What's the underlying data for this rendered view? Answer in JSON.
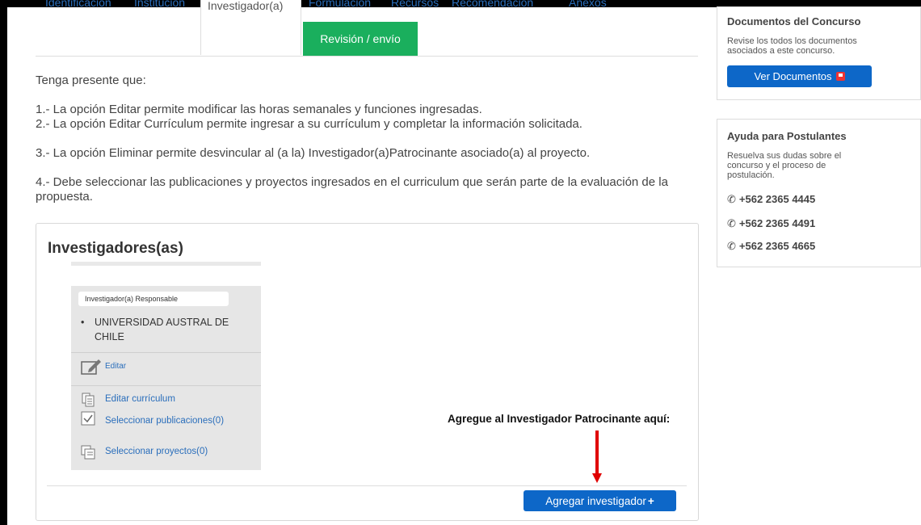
{
  "tabs": {
    "items": [
      "Identificación",
      "Institución",
      "Investigador(a)",
      "Formulación",
      "Recursos",
      "Recomendación",
      "Anexos"
    ],
    "active": "Investigador(a)",
    "review_tab": "Revisión / envío"
  },
  "notes": {
    "intro": "Tenga presente que:",
    "lines": [
      "1.- La opción Editar permite modificar las horas semanales y funciones ingresadas.",
      "2.- La opción Editar Currículum permite ingresar a su currículum y completar la información solicitada.",
      "3.- La opción Eliminar permite desvincular al (a la) Investigador(a)Patrocinante asociado(a) al proyecto.",
      "4.- Debe seleccionar las publicaciones y proyectos ingresados en el curriculum que serán parte de la evaluación de la propuesta."
    ]
  },
  "investigators": {
    "title": "Investigadores(as)",
    "card": {
      "role": "Investigador(a) Responsable",
      "institution": "UNIVERSIDAD AUSTRAL DE CHILE",
      "edit": "Editar",
      "edit_cv": "Editar currículum",
      "select_pubs": "Seleccionar publicaciones(0)",
      "select_projects": "Seleccionar proyectos(0)"
    },
    "add_button": "Agregar investigador",
    "add_icon": "+"
  },
  "callout": "Agregue al Investigador Patrocinante aquí:",
  "sidebar": {
    "docs": {
      "title": "Documentos del Concurso",
      "text": "Revise los todos los documentos asociados a este concurso.",
      "button": "Ver Documentos"
    },
    "help": {
      "title": "Ayuda para Postulantes",
      "text": "Resuelva sus dudas sobre el concurso y el proceso de postulación.",
      "phones": [
        "+562 2365 4445",
        "+562 2365 4491",
        "+562 2365 4665"
      ]
    }
  },
  "colors": {
    "primary": "#0d67c8",
    "green": "#1aaf5d",
    "link": "#2a6ebb",
    "arrow": "#e00000"
  }
}
